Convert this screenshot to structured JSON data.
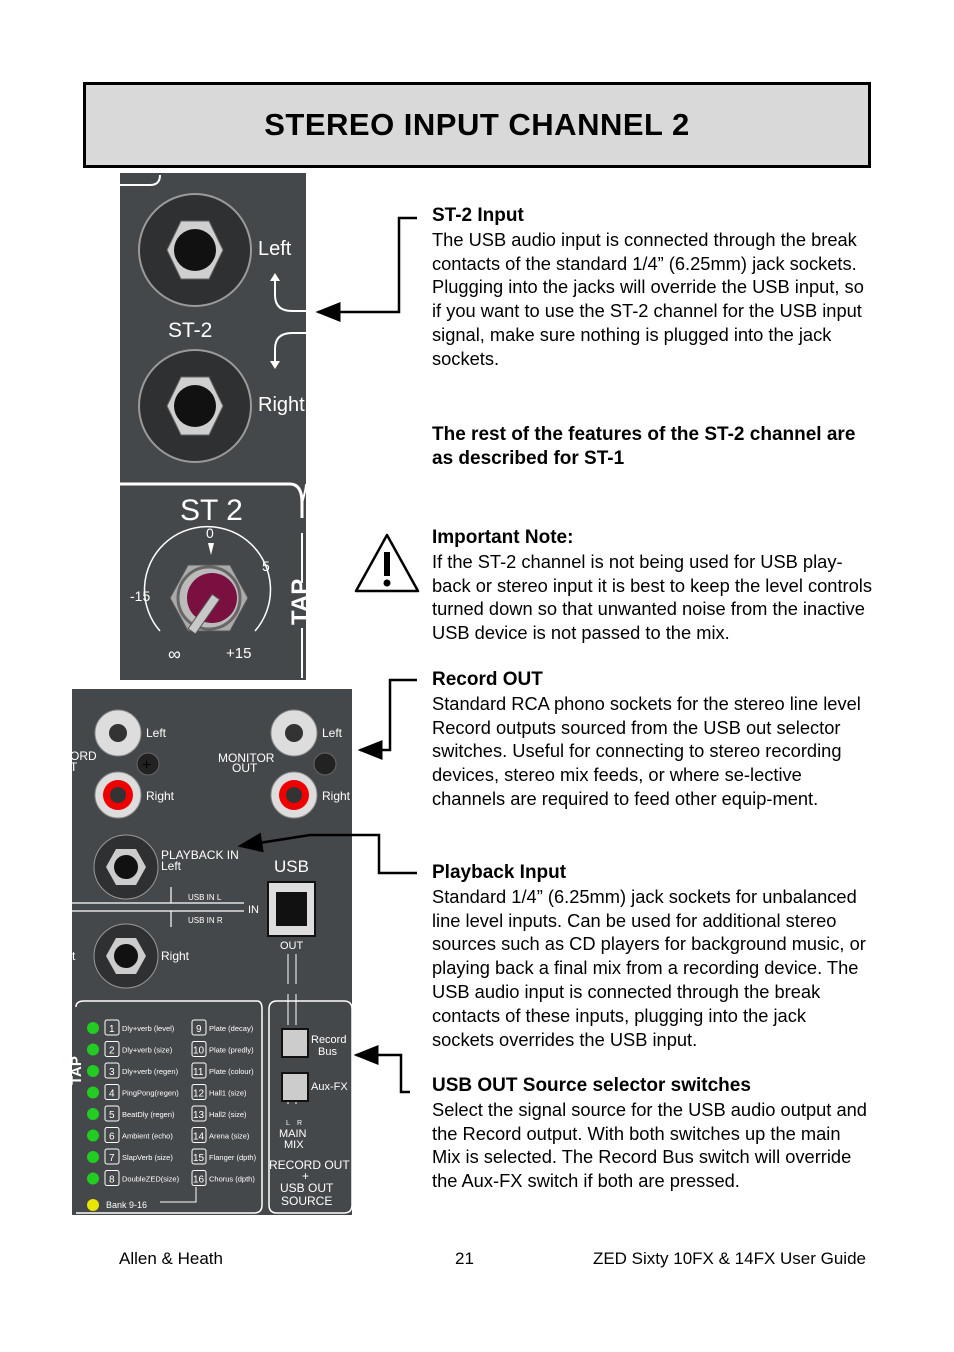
{
  "title": "STEREO INPUT CHANNEL 2",
  "sections": [
    {
      "heading": "ST-2 Input",
      "body": "The USB audio input is connected through the break contacts of the standard 1/4” (6.25mm) jack sockets. Plugging into the jacks will override the USB input, so if you want to use the ST-2 channel for the USB input  signal, make sure nothing is plugged into the jack sockets."
    },
    {
      "heading": "The rest of the features of the ST-2 channel are as described for ST-1",
      "body": ""
    },
    {
      "heading": "Important Note:",
      "body": "If the ST-2 channel is not being used for USB play-back or stereo input it is best to keep the level controls turned down so that unwanted noise from the inactive USB device is not passed to the mix."
    },
    {
      "heading": "Record OUT",
      "body": "Standard RCA phono sockets for the stereo line level Record outputs sourced from the USB out selector switches. Useful for connecting to stereo recording devices, stereo mix feeds, or where se-lective channels are required to feed other equip-ment."
    },
    {
      "heading": "Playback Input",
      "body": "Standard 1/4” (6.25mm) jack sockets for unbalanced line level inputs. Can be used for additional stereo sources such as CD players for background music, or playing back a final mix from a recording device. The USB audio input is connected through the break contacts of these inputs, plugging into the jack sockets overrides the USB input."
    },
    {
      "heading": "USB OUT Source selector switches",
      "body": "Select the signal source for the USB audio output and the Record output. With both switches up the main Mix is selected. The Record Bus switch will override the Aux-FX switch if both are pressed."
    }
  ],
  "panel_top": {
    "left": "Left",
    "channel": "ST-2",
    "right": "Right",
    "strip_name": "ST 2",
    "scale": {
      "zero": "0",
      "five": "5",
      "minus15": "-15",
      "inf": "∞",
      "plus15": "+15"
    },
    "tap": "TAP",
    "knob_color": "#7a1040"
  },
  "panel_bottom": {
    "rec_left": "Left",
    "rec_right": "Right",
    "rec_label_1": "ORD",
    "rec_label_2": "T",
    "mon_label_1": "MONITOR",
    "mon_label_2": "OUT",
    "mon_left": "Left",
    "mon_right": "Right",
    "playback_1": "PLAYBACK IN",
    "playback_2": "Left",
    "playback_right": "Right",
    "playback_cut": "t",
    "usb": "USB",
    "usb_in_l": "USB IN L",
    "usb_in_r": "USB IN R",
    "in": "IN",
    "out": "OUT",
    "record_bus_1": "Record",
    "record_bus_2": "Bus",
    "aux_fx": "Aux-FX",
    "lr_l": "L",
    "lr_r": "R",
    "main_1": "MAIN",
    "main_2": "MIX",
    "src_1": "RECORD OUT",
    "src_2": "+",
    "src_3": "USB OUT",
    "src_4": "SOURCE",
    "tap": "TAP",
    "bank": "Bank 9-16",
    "led_green": "#22cc22",
    "led_yellow": "#e6e600",
    "fx": [
      "Dly+verb (level)",
      "Dly+verb (size)",
      "Dly+verb (regen)",
      "PingPong(regen)",
      "BeatDly (regen)",
      "Ambient (echo)",
      "SlapVerb (size)",
      "DoubleZED(size)",
      "Plate (decay)",
      "Plate (predly)",
      "Plate (colour)",
      "Hall1 (size)",
      "Hall2 (size)",
      "Arena (size)",
      "Flanger (dpth)",
      "Chorus (dpth)"
    ]
  },
  "footer": {
    "left": "Allen & Heath",
    "page": "21",
    "right": "ZED Sixty 10FX & 14FX  User Guide"
  }
}
